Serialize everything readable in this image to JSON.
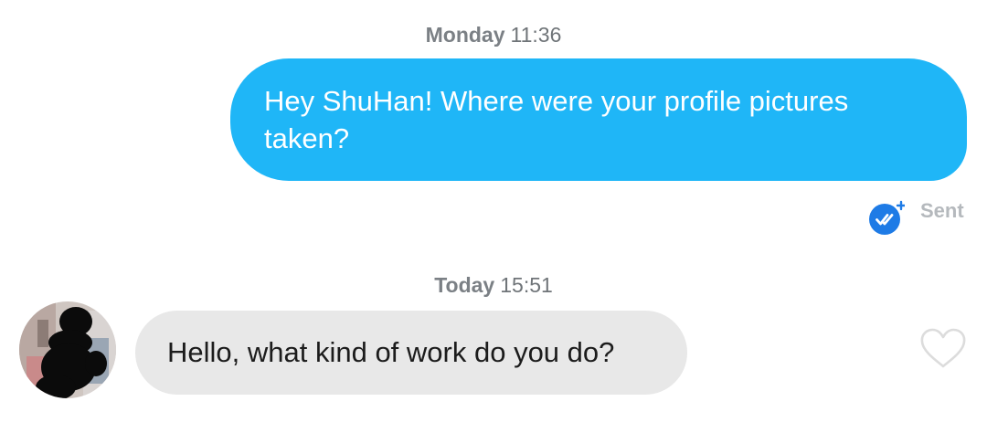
{
  "conversation": {
    "outgoing_timestamp": {
      "day": "Monday",
      "time": "11:36"
    },
    "outgoing_message": "Hey ShuHan! Where were your profile pictures taken?",
    "outgoing_status": "Sent",
    "incoming_timestamp": {
      "day": "Today",
      "time": "15:51"
    },
    "incoming_message": "Hello, what kind of work do you do?"
  },
  "icons": {
    "read_receipt": "double-check-badge-icon",
    "like": "heart-outline-icon"
  },
  "colors": {
    "outgoing_bubble": "#1fb6f7",
    "incoming_bubble": "#e8e8e8",
    "read_badge": "#1e7be6",
    "timestamp_text": "#6f7478",
    "sent_text": "#b5b9bd"
  }
}
